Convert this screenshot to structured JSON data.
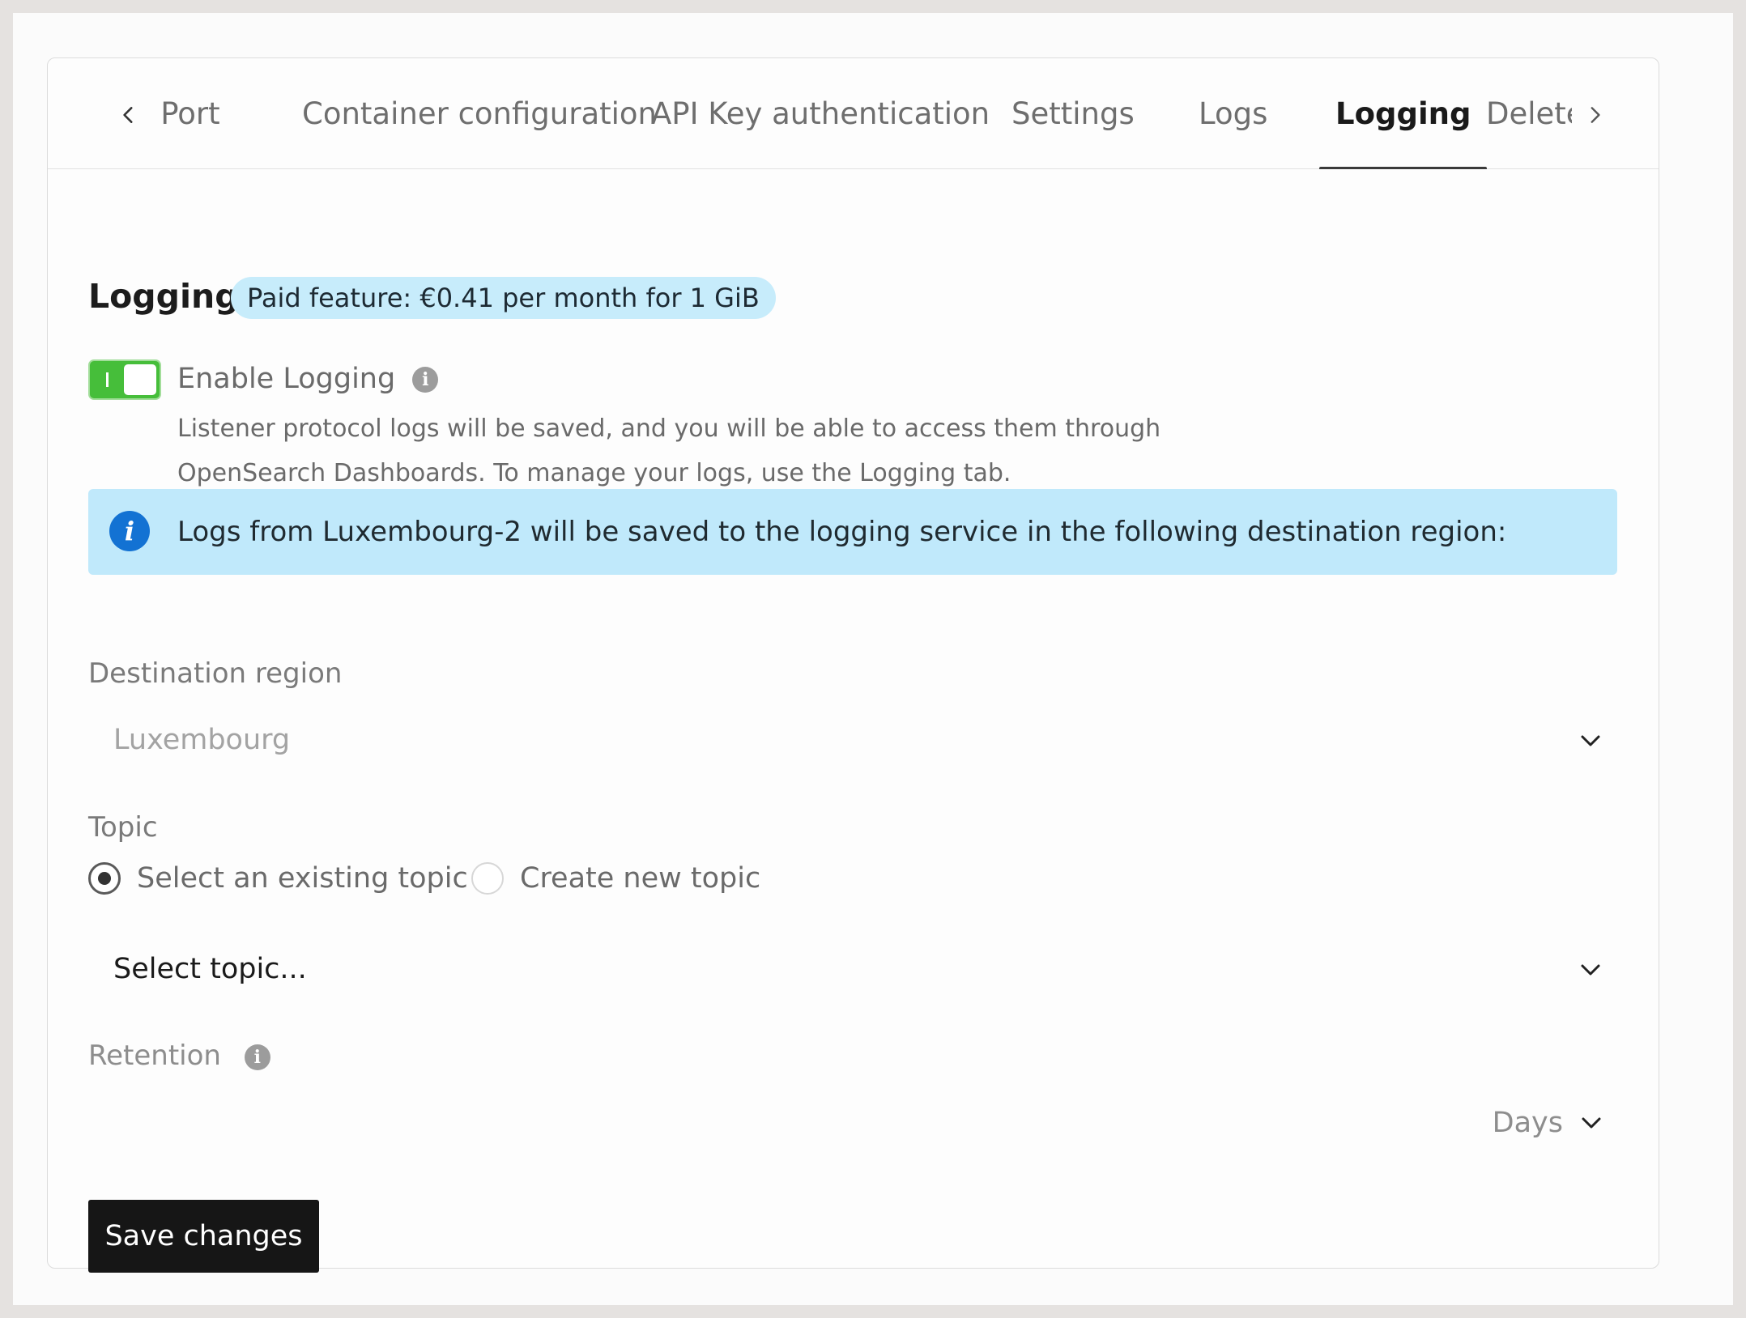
{
  "tabs": {
    "items": [
      {
        "label": ": Port"
      },
      {
        "label": "Container configuration"
      },
      {
        "label": "API Key authentication"
      },
      {
        "label": "Settings"
      },
      {
        "label": "Logs"
      },
      {
        "label": "Logging"
      },
      {
        "label": "Delete"
      }
    ],
    "active": "Logging"
  },
  "logging": {
    "title": "Logging",
    "badge": "Paid feature: €0.41 per month for 1 GiB",
    "toggle_label": "Enable Logging",
    "toggle_on": true,
    "help_line1": "Listener protocol logs will be saved, and you will be able to access them through",
    "help_line2": "OpenSearch Dashboards. To manage your logs, use the Logging tab.",
    "alert_text": "Logs from Luxembourg-2 will be saved to the logging service in the following destination region:"
  },
  "destination": {
    "label": "Destination region",
    "value": "Luxembourg"
  },
  "topic": {
    "label": "Topic",
    "option_existing": "Select an existing topic",
    "option_new": "Create new topic",
    "selected": "existing",
    "select_placeholder": "Select topic..."
  },
  "retention": {
    "label": "Retention",
    "unit": "Days"
  },
  "actions": {
    "save_label": "Save changes"
  },
  "colors": {
    "accent_toggle": "#46be3a",
    "badge_bg": "#c7ecfb",
    "alert_bg": "#c0e9fb",
    "alert_icon": "#1372d3",
    "primary_button": "#161616"
  }
}
